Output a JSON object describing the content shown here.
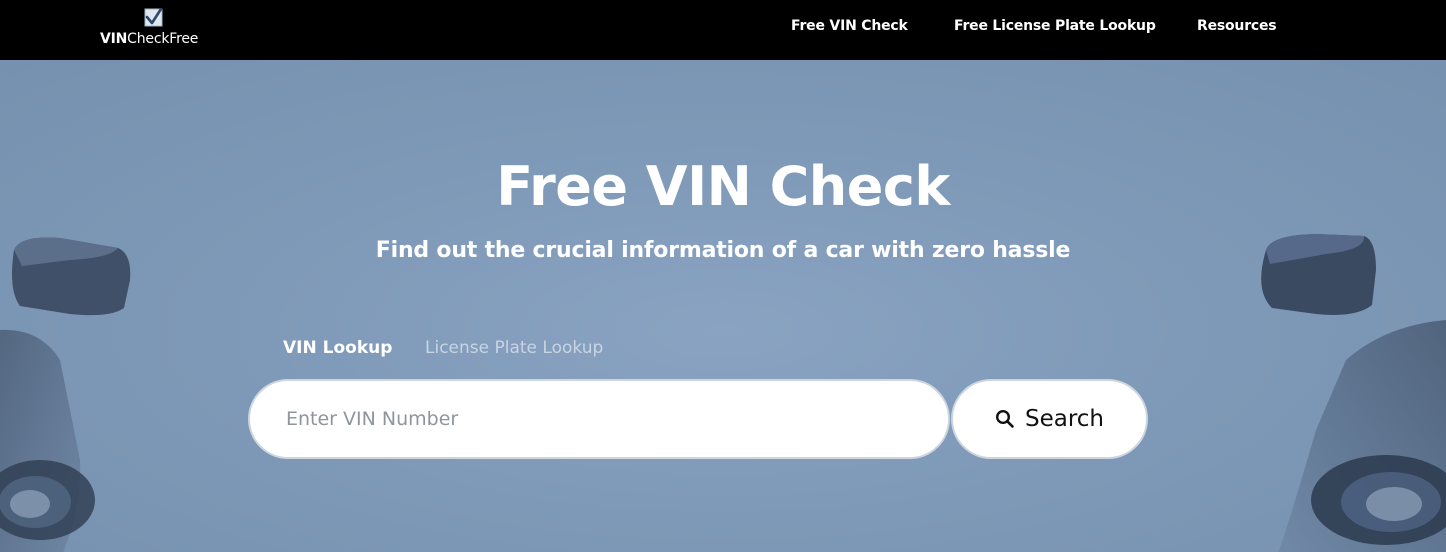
{
  "header": {
    "logo_bold": "VIN",
    "logo_regular": "CheckFree",
    "nav": [
      {
        "label": "Free VIN Check"
      },
      {
        "label": "Free License Plate Lookup"
      },
      {
        "label": "Resources"
      }
    ]
  },
  "hero": {
    "title": "Free VIN Check",
    "subtitle": "Find out the crucial information of a car with zero hassle",
    "tabs": [
      {
        "label": "VIN Lookup",
        "active": true
      },
      {
        "label": "License Plate Lookup",
        "active": false
      }
    ],
    "search": {
      "placeholder": "Enter VIN Number",
      "value": "",
      "button_label": "Search",
      "button_icon": "search-icon"
    }
  },
  "colors": {
    "header_bg": "#000000",
    "hero_bg": "#7f99b8",
    "text": "#ffffff",
    "inactive_tab": "#c9d4e2"
  }
}
